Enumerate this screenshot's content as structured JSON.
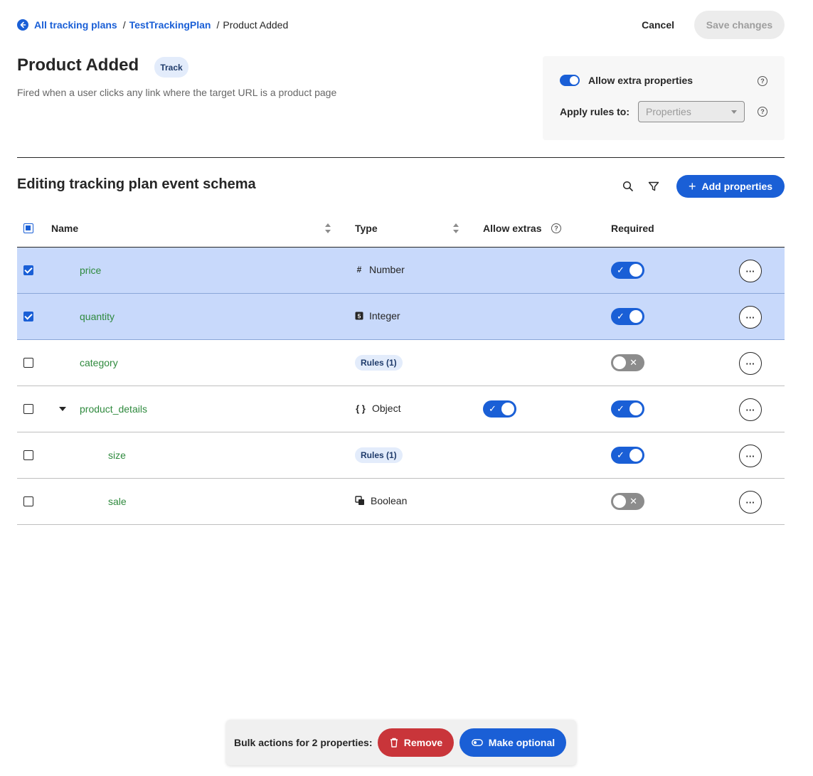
{
  "breadcrumb": {
    "items": [
      "All tracking plans",
      "TestTrackingPlan"
    ],
    "separator": "/",
    "current": "Product Added"
  },
  "header_actions": {
    "cancel_label": "Cancel",
    "save_label": "Save changes"
  },
  "event": {
    "title": "Product Added",
    "badge": "Track",
    "description": "Fired when a user clicks any link where the target URL is a product page"
  },
  "settings": {
    "allow_extra_label": "Allow extra properties",
    "allow_extra_on": true,
    "apply_rules_label": "Apply rules to:",
    "apply_rules_placeholder": "Properties"
  },
  "schema": {
    "title": "Editing tracking plan event schema",
    "add_label": "Add properties",
    "columns": {
      "name": "Name",
      "type": "Type",
      "allow_extras": "Allow extras",
      "required": "Required"
    },
    "rows": [
      {
        "name": "price",
        "type": "Number",
        "type_icon": "#",
        "selected": true,
        "required": true
      },
      {
        "name": "quantity",
        "type": "Integer",
        "type_icon": "5",
        "selected": true,
        "required": true
      },
      {
        "name": "category",
        "rules": "Rules (1)",
        "selected": false,
        "required": false
      },
      {
        "name": "product_details",
        "type": "Object",
        "type_icon": "{ }",
        "selected": false,
        "allow_extras": true,
        "required": true,
        "expanded": true
      },
      {
        "name": "size",
        "rules": "Rules (1)",
        "selected": false,
        "required": true,
        "child": true
      },
      {
        "name": "sale",
        "type": "Boolean",
        "type_icon": "bool",
        "selected": false,
        "required": false,
        "child": true
      }
    ]
  },
  "bulk": {
    "label": "Bulk actions for 2 properties:",
    "remove_label": "Remove",
    "optional_label": "Make optional"
  },
  "colors": {
    "accent": "#1a5fd6",
    "danger": "#c9353a",
    "name_green": "#2f8a3e",
    "selected_row": "#c8d9fb"
  }
}
